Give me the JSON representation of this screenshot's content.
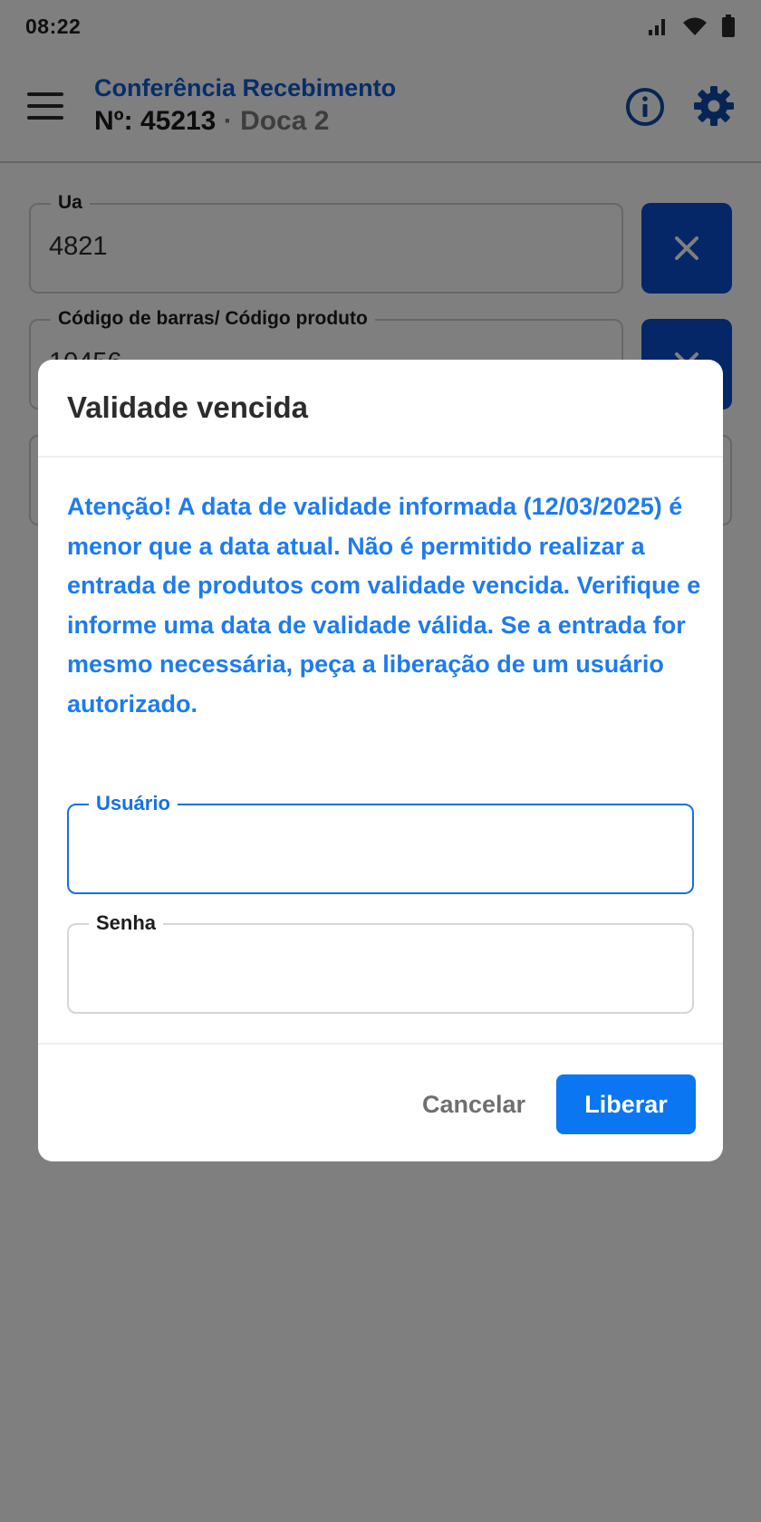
{
  "status_bar": {
    "time": "08:22",
    "icons": [
      "signal-icon",
      "wifi-icon",
      "battery-icon"
    ]
  },
  "app_bar": {
    "title": "Conferência Recebimento",
    "number_label": "Nº: 45213",
    "separator": "·",
    "dock": "Doca 2",
    "icons": [
      "menu-icon",
      "info-icon",
      "settings-icon"
    ]
  },
  "form": {
    "ua": {
      "label": "Ua",
      "value": "4821"
    },
    "barcode": {
      "label": "Código de barras/ Código produto",
      "value": "10456"
    }
  },
  "dialog": {
    "title": "Validade vencida",
    "message": "Atenção! A data de validade informada (12/03/2025) é menor que a data atual. Não é permitido realizar a entrada de produtos com validade vencida. Verifique e informe uma data de validade válida. Se a entrada for mesmo necessária, peça a liberação de um usuário autorizado.",
    "user_field": {
      "label": "Usuário",
      "value": ""
    },
    "password_field": {
      "label": "Senha",
      "value": ""
    },
    "cancel_label": "Cancelar",
    "release_label": "Liberar"
  },
  "colors": {
    "accent": "#0a76f2",
    "title_blue": "#0b5cd5",
    "message_blue": "#1d7bf0",
    "clear_button": "#0a4fd1",
    "scrim": "rgba(0,0,0,0.5)"
  }
}
